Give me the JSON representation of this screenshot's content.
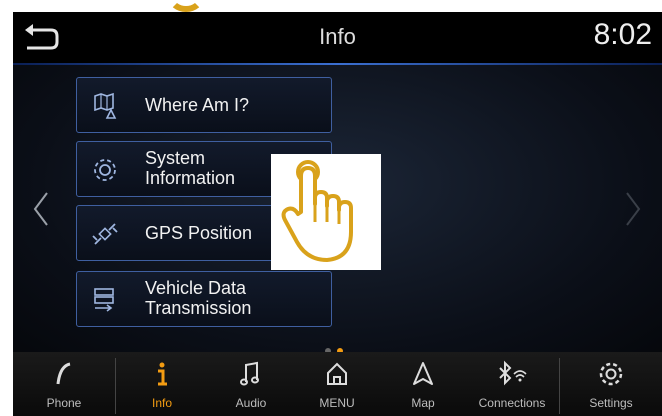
{
  "header": {
    "title": "Info",
    "clock": "8:02"
  },
  "menu": {
    "items": [
      {
        "label_lines": [
          "Where Am I?"
        ],
        "icon": "map-location-icon"
      },
      {
        "label_lines": [
          "System",
          "Information"
        ],
        "icon": "gear-icon"
      },
      {
        "label_lines": [
          "GPS Position"
        ],
        "icon": "satellite-icon"
      },
      {
        "label_lines": [
          "Vehicle Data",
          "Transmission"
        ],
        "icon": "data-transmission-icon"
      }
    ]
  },
  "pager": {
    "current_page": 2,
    "total_pages": 2
  },
  "overlay": {
    "icon": "hand-pointer-icon",
    "color": "#d9a21b"
  },
  "colors": {
    "accent": "#f39c12",
    "button_border": "#3f5fa0",
    "inactive_label": "#bdbdbd"
  },
  "bottom_nav": {
    "items": [
      {
        "label": "Phone",
        "icon": "phone-icon",
        "active": false
      },
      {
        "label": "Info",
        "icon": "info-icon",
        "active": true
      },
      {
        "label": "Audio",
        "icon": "music-note-icon",
        "active": false
      },
      {
        "label": "MENU",
        "icon": "home-icon",
        "active": false
      },
      {
        "label": "Map",
        "icon": "navigation-arrow-icon",
        "active": false
      },
      {
        "label": "Connections",
        "icon": "bluetooth-wifi-icon",
        "active": false
      },
      {
        "label": "Settings",
        "icon": "gear-icon",
        "active": false
      }
    ]
  }
}
